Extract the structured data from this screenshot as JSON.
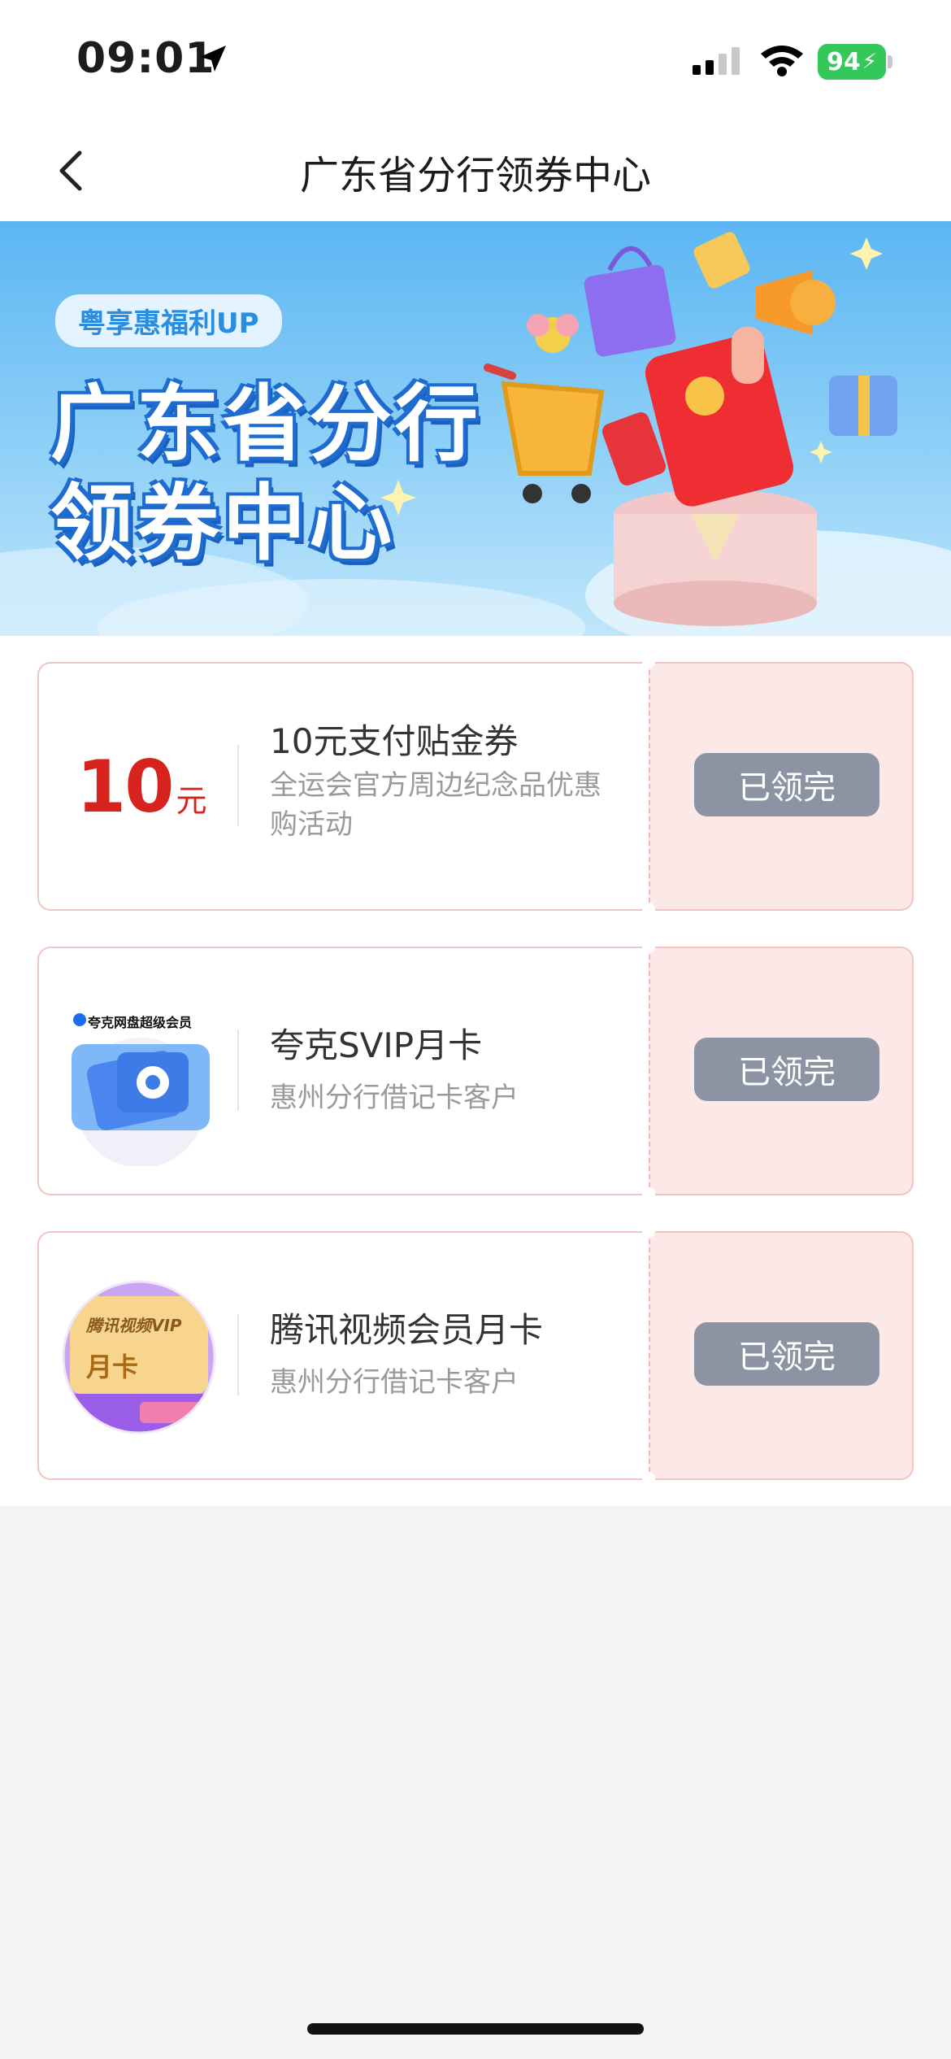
{
  "status_bar": {
    "time": "09:01",
    "battery": "94",
    "icons": [
      "location-arrow-icon",
      "cellular-signal-icon",
      "wifi-icon",
      "battery-charging-icon"
    ]
  },
  "nav": {
    "back_icon": "chevron-left-icon",
    "title": "广东省分行领券中心"
  },
  "banner": {
    "tag": "粤享惠福利UP",
    "title_line1": "广东省分行",
    "title_line2": "领券中心"
  },
  "coupons": [
    {
      "amount": "10",
      "unit": "元",
      "title": "10元支付贴金券",
      "desc": "全运会官方周边纪念品优惠购活动",
      "button": "已领完"
    },
    {
      "thumb_label": "夸克网盘超级会员",
      "title": "夸克SVIP月卡",
      "desc": "惠州分行借记卡客户",
      "button": "已领完"
    },
    {
      "thumb_label": "腾讯视频VIP",
      "thumb_badge": "月卡",
      "title": "腾讯视频会员月卡",
      "desc": "惠州分行借记卡客户",
      "button": "已领完"
    }
  ],
  "colors": {
    "accent_red": "#d6231e",
    "button_gray": "#8c94a3",
    "coupon_border": "#f0c4c0",
    "coupon_right_bg": "#fde8e8",
    "banner_blue": "#5cb6f3"
  }
}
